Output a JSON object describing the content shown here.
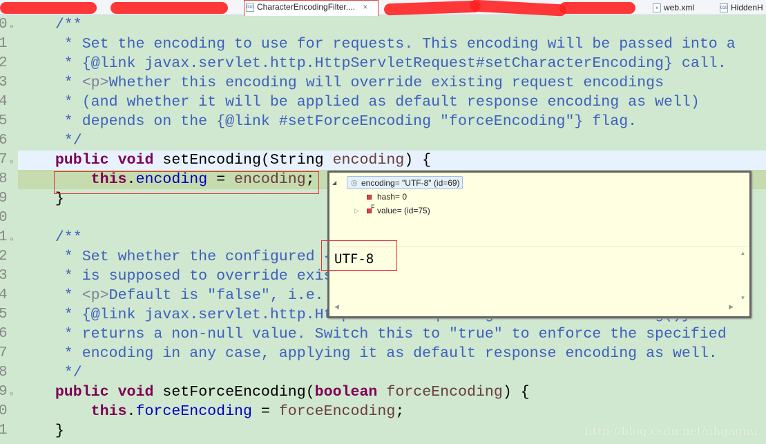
{
  "tabs": [
    {
      "label": "",
      "redacted": true
    },
    {
      "label": "",
      "redacted": true
    },
    {
      "label": "CharacterEncodingFilter....",
      "active": true,
      "close": "×"
    },
    {
      "label": "",
      "redacted": true
    },
    {
      "label": "",
      "redacted": true
    },
    {
      "label": "",
      "redacted": true
    },
    {
      "label": "web.xml"
    },
    {
      "label": "HiddenH"
    }
  ],
  "editor": {
    "lines": [
      {
        "n": "0",
        "fold": true,
        "tokens": [
          [
            "c",
            "    /**"
          ]
        ]
      },
      {
        "n": "1",
        "tokens": [
          [
            "c",
            "     * Set the encoding to use for requests. This encoding will be passed into a"
          ]
        ]
      },
      {
        "n": "2",
        "tokens": [
          [
            "c",
            "     * {@link javax.servlet.http.HttpServletRequest#setCharacterEncoding} call."
          ]
        ]
      },
      {
        "n": "3",
        "tokens": [
          [
            "c",
            "     * "
          ],
          [
            "h",
            "<p>"
          ],
          [
            "c",
            "Whether this encoding will override existing request encodings"
          ]
        ]
      },
      {
        "n": "4",
        "tokens": [
          [
            "c",
            "     * (and whether it will be applied as default response encoding as well)"
          ]
        ]
      },
      {
        "n": "5",
        "tokens": [
          [
            "c",
            "     * depends on the {@link #setForceEncoding \"forceEncoding\"} flag."
          ]
        ]
      },
      {
        "n": "6",
        "tokens": [
          [
            "c",
            "     */"
          ]
        ]
      },
      {
        "n": "7",
        "fold": true,
        "style": "current",
        "tokens": [
          [
            "k",
            "    public"
          ],
          [
            "t",
            " "
          ],
          [
            "k",
            "void"
          ],
          [
            "t",
            " setEncoding(String "
          ],
          [
            "p",
            "encoding"
          ],
          [
            "t",
            ") {"
          ]
        ]
      },
      {
        "n": "8",
        "style": "debug",
        "tokens": [
          [
            "t",
            "        "
          ],
          [
            "k",
            "this"
          ],
          [
            "t",
            "."
          ],
          [
            "f",
            "encoding"
          ],
          [
            "t",
            " = "
          ],
          [
            "p",
            "encoding"
          ],
          [
            "t",
            ";"
          ]
        ]
      },
      {
        "n": "9",
        "tokens": [
          [
            "t",
            "    }"
          ]
        ]
      },
      {
        "n": "0",
        "tokens": []
      },
      {
        "n": "1",
        "fold": true,
        "tokens": [
          [
            "c",
            "    /**"
          ]
        ]
      },
      {
        "n": "2",
        "tokens": [
          [
            "c",
            "     * Set whether the configured {"
          ]
        ]
      },
      {
        "n": "3",
        "tokens": [
          [
            "c",
            "     * is supposed to override exis"
          ]
        ]
      },
      {
        "n": "4",
        "tokens": [
          [
            "c",
            "     * "
          ],
          [
            "h",
            "<p>"
          ],
          [
            "c",
            "Default is \"false\", i.e."
          ]
        ]
      },
      {
        "n": "5",
        "tokens": [
          [
            "c",
            "     * {@link javax.servlet.http.HttpServletRequest#getCharacterEncoding()}"
          ]
        ]
      },
      {
        "n": "6",
        "tokens": [
          [
            "c",
            "     * returns a non-null value. Switch this to \"true\" to enforce the specified"
          ]
        ]
      },
      {
        "n": "7",
        "tokens": [
          [
            "c",
            "     * encoding in any case, applying it as default response encoding as well."
          ]
        ]
      },
      {
        "n": "8",
        "tokens": [
          [
            "c",
            "     */"
          ]
        ]
      },
      {
        "n": "9",
        "fold": true,
        "tokens": [
          [
            "k",
            "    public"
          ],
          [
            "t",
            " "
          ],
          [
            "k",
            "void"
          ],
          [
            "t",
            " setForceEncoding("
          ],
          [
            "k",
            "boolean"
          ],
          [
            "t",
            " "
          ],
          [
            "p",
            "forceEncoding"
          ],
          [
            "t",
            ") {"
          ]
        ]
      },
      {
        "n": "0",
        "tokens": [
          [
            "t",
            "        "
          ],
          [
            "k",
            "this"
          ],
          [
            "t",
            "."
          ],
          [
            "f",
            "forceEncoding"
          ],
          [
            "t",
            " = "
          ],
          [
            "p",
            "forceEncoding"
          ],
          [
            "t",
            ";"
          ]
        ]
      },
      {
        "n": "1",
        "tokens": [
          [
            "t",
            "    }"
          ]
        ]
      }
    ]
  },
  "inspect_popup": {
    "root": "encoding= \"UTF-8\" (id=69)",
    "children": [
      {
        "label": "hash= 0"
      },
      {
        "label": "value= (id=75)",
        "expandable": true,
        "final_marker": "F"
      }
    ],
    "detail_value": "UTF-8"
  },
  "watermark": "http://blog.csdn.net/uhgagnu",
  "colors": {
    "editor_bg": "#cfe8cf",
    "javadoc": "#3f5fbf",
    "keyword": "#7f0055",
    "field": "#0000c0",
    "param": "#6a3e3e",
    "popup_bg": "#ffffe1",
    "highlight_box": "#dd3333"
  }
}
